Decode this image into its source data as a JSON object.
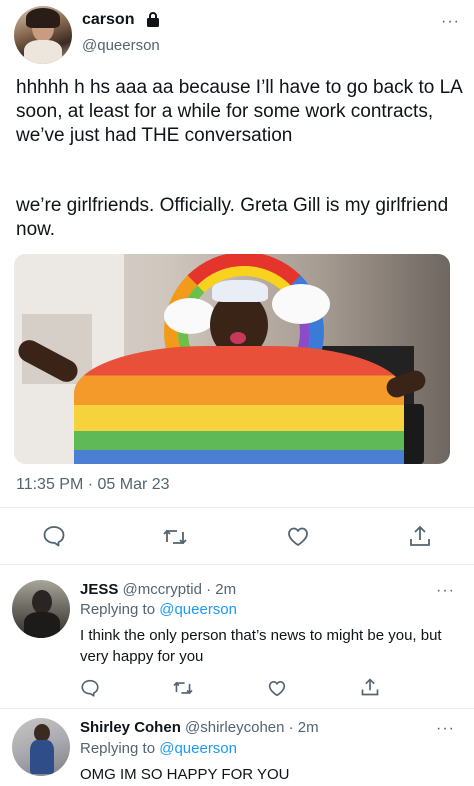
{
  "main_tweet": {
    "display_name": "carson",
    "handle": "@queerson",
    "text_para1": "hhhhh h hs aaa aa because I’ll have to go back to LA soon, at least for a while for some work contracts, we’ve just had THE conversation",
    "text_para2": "we’re girlfriends. Officially. Greta Gill is my girlfriend now.",
    "timestamp": "11:35 PM · 05 Mar 23",
    "more": "···"
  },
  "replies": [
    {
      "display_name": "JESS",
      "handle_time": "@mccryptid · 2m",
      "replying_prefix": "Replying to",
      "replying_to": "@queerson",
      "text": "I think the only person that’s news to might be you, but very happy for you",
      "more": "···"
    },
    {
      "display_name": "Shirley Cohen",
      "handle_time": "@shirleycohen · 2m",
      "replying_prefix": "Replying to",
      "replying_to": "@queerson",
      "text": "OMG IM SO HAPPY FOR YOU",
      "more": "···"
    }
  ],
  "icons": [
    "lock-icon",
    "reply-icon",
    "retweet-icon",
    "like-icon",
    "share-icon",
    "more-icon"
  ],
  "colors": {
    "accent": "#1d9bf0",
    "text": "#0f1419",
    "secondary": "#536471",
    "divider": "#e6ecf0"
  }
}
